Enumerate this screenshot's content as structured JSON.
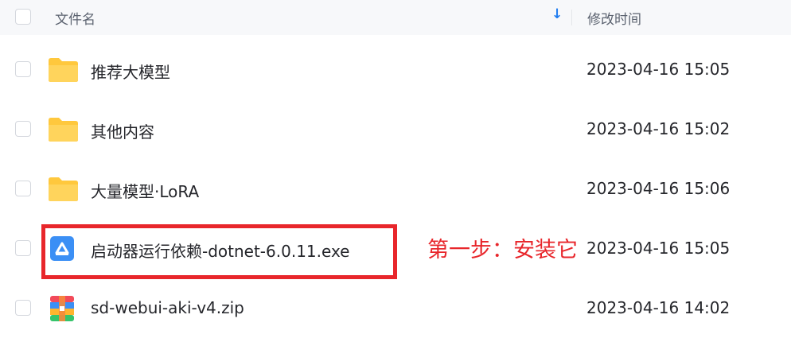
{
  "header": {
    "name_label": "文件名",
    "sort_arrow": "↓",
    "time_label": "修改时间"
  },
  "files": [
    {
      "name": "推荐大模型",
      "modified": "2023-04-16 15:05",
      "icon": "folder-icon"
    },
    {
      "name": "其他内容",
      "modified": "2023-04-16 15:02",
      "icon": "folder-icon"
    },
    {
      "name": "大量模型·LoRA",
      "modified": "2023-04-16 15:06",
      "icon": "folder-icon"
    },
    {
      "name": "启动器运行依赖-dotnet-6.0.11.exe",
      "modified": "2023-04-16 15:05",
      "icon": "exe-file-icon"
    },
    {
      "name": "sd-webui-aki-v4.zip",
      "modified": "2023-04-16 14:02",
      "icon": "zip-file-icon"
    }
  ],
  "annotation": {
    "text": "第一步：安装它"
  },
  "colors": {
    "accent": "#1e7cf0",
    "annotation": "#e8262b",
    "folder": "#ffc83d"
  }
}
